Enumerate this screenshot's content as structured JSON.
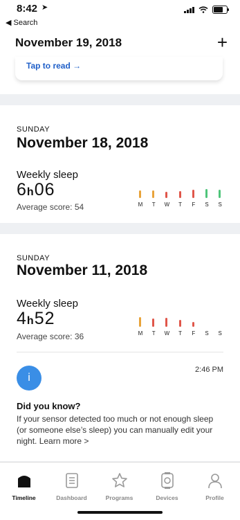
{
  "status_bar": {
    "time": "8:42",
    "back_label": "◀ Search"
  },
  "header": {
    "date": "November 19, 2018",
    "add_icon": "plus-icon"
  },
  "previous_card": {
    "link_text": "Tap to read →"
  },
  "weeks": [
    {
      "day_label": "SUNDAY",
      "date": "November 18, 2018",
      "weekly_sleep_label": "Weekly sleep",
      "sleep_hours": "6",
      "sleep_minutes": "06",
      "avg_score_text": "Average score: 54",
      "day_letters": [
        "M",
        "T",
        "W",
        "T",
        "F",
        "S",
        "S"
      ],
      "day_levels": [
        0.6,
        0.6,
        0.5,
        0.55,
        0.65,
        0.75,
        0.65
      ],
      "day_colors": [
        "#e8a33a",
        "#e8a33a",
        "#e0564a",
        "#e0564a",
        "#e0564a",
        "#4fc57a",
        "#4fc57a"
      ]
    },
    {
      "day_label": "SUNDAY",
      "date": "November 11, 2018",
      "weekly_sleep_label": "Weekly sleep",
      "sleep_hours": "4",
      "sleep_minutes": "52",
      "avg_score_text": "Average score: 36",
      "day_letters": [
        "M",
        "T",
        "W",
        "T",
        "F",
        "S",
        "S"
      ],
      "day_levels": [
        0.8,
        0.65,
        0.7,
        0.55,
        0.4,
        0,
        0
      ],
      "day_colors": [
        "#e8a33a",
        "#e0564a",
        "#e0564a",
        "#e0564a",
        "#e0564a",
        "#cccccc",
        "#cccccc"
      ]
    }
  ],
  "did_you_know": {
    "icon": "info-icon",
    "icon_glyph": "i",
    "time": "2:46 PM",
    "title": "Did you know?",
    "text": "If your sensor detected too much or not enough sleep (or someone else’s sleep) you can manually edit your night. Learn more >"
  },
  "tabs": [
    {
      "label": "Timeline",
      "icon": "timeline-icon",
      "active": true
    },
    {
      "label": "Dashboard",
      "icon": "dashboard-icon",
      "active": false
    },
    {
      "label": "Programs",
      "icon": "star-icon",
      "active": false
    },
    {
      "label": "Devices",
      "icon": "watch-icon",
      "active": false
    },
    {
      "label": "Profile",
      "icon": "profile-icon",
      "active": false
    }
  ],
  "colors": {
    "accent": "#1f5fc8",
    "info_blue": "#3a8ee6"
  }
}
